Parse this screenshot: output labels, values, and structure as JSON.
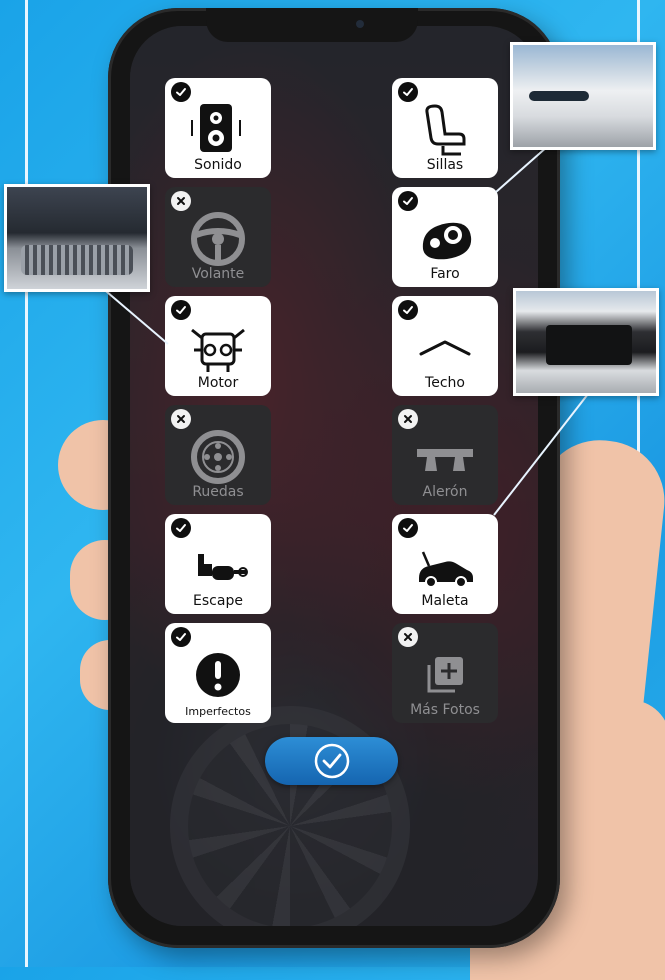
{
  "tiles": [
    {
      "label": "Sonido",
      "status": "checked",
      "icon": "speaker-icon"
    },
    {
      "label": "Sillas",
      "status": "checked",
      "icon": "seat-icon"
    },
    {
      "label": "Volante",
      "status": "unchecked",
      "icon": "steering-wheel-icon"
    },
    {
      "label": "Faro",
      "status": "checked",
      "icon": "headlight-icon"
    },
    {
      "label": "Motor",
      "status": "checked",
      "icon": "engine-icon"
    },
    {
      "label": "Techo",
      "status": "checked",
      "icon": "roof-icon"
    },
    {
      "label": "Ruedas",
      "status": "unchecked",
      "icon": "wheel-icon"
    },
    {
      "label": "Alerón",
      "status": "unchecked",
      "icon": "spoiler-icon"
    },
    {
      "label": "Escape",
      "status": "checked",
      "icon": "exhaust-icon"
    },
    {
      "label": "Maleta",
      "status": "checked",
      "icon": "trunk-icon"
    },
    {
      "label": "Imperfectos",
      "status": "checked",
      "icon": "exclamation-icon"
    },
    {
      "label": "Más Fotos",
      "status": "unchecked",
      "icon": "add-photos-icon"
    }
  ],
  "confirm": {
    "icon": "check-circle-icon"
  },
  "photos": [
    {
      "name": "engine-photo",
      "subject": "engine bay"
    },
    {
      "name": "headlight-photo",
      "subject": "headlight"
    },
    {
      "name": "trunk-photo",
      "subject": "open trunk"
    }
  ],
  "colors": {
    "accent": "#1e78c6",
    "tile_on": "#ffffff",
    "tile_off": "#2b2b2d",
    "background": "#22a8ea"
  }
}
